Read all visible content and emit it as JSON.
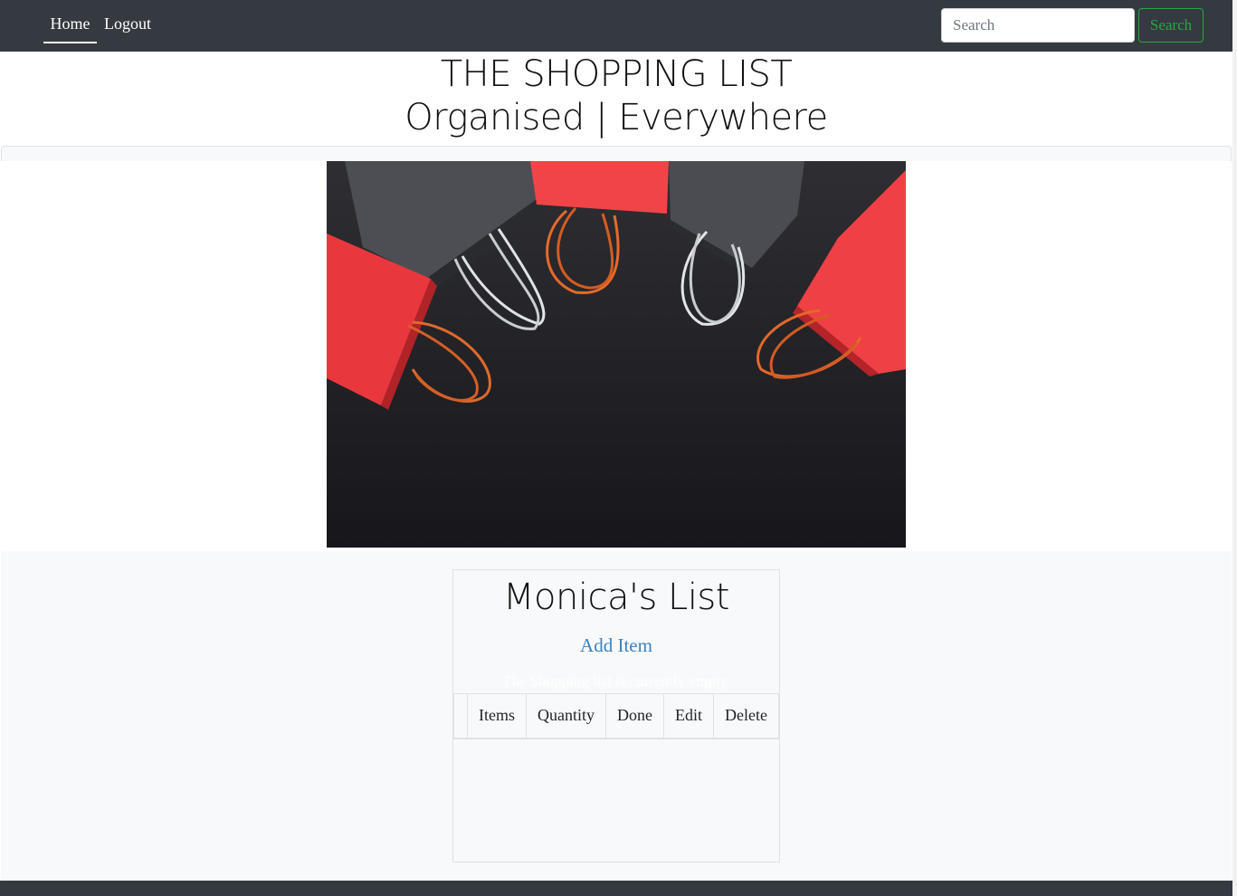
{
  "nav": {
    "home_label": "Home",
    "logout_label": "Logout",
    "search_placeholder": "Search",
    "search_button_label": "Search"
  },
  "header": {
    "title": "THE SHOPPING LIST",
    "tagline": "Organised | Everywhere"
  },
  "hero_image": {
    "icon": "shopping-bags-image"
  },
  "list": {
    "title": "Monica's List",
    "add_item_label": "Add Item",
    "empty_message": "The Shopping list is currently empty.",
    "columns": [
      "",
      "Items",
      "Quantity",
      "Done",
      "Edit",
      "Delete"
    ]
  },
  "colors": {
    "navbar": "#343a40",
    "accent_link": "#3b82c4",
    "search_button": "#28a745",
    "panel_bg": "#f8f9fa"
  }
}
